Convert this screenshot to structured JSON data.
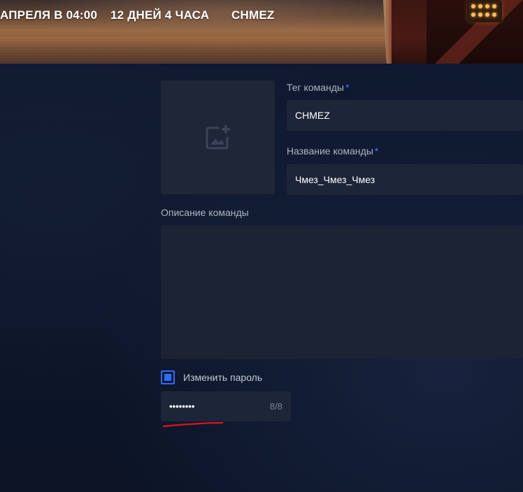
{
  "banner": {
    "date_text": "АПРЕЛЯ В 04:00",
    "countdown_text": "12 ДНЕЙ 4 ЧАСА",
    "team_text": "CHMEZ"
  },
  "form": {
    "logo_upload": {
      "icon": "add-photo-icon"
    },
    "team_tag": {
      "label": "Тег команды",
      "required_mark": "*",
      "value": "CHMEZ"
    },
    "team_name": {
      "label": "Название команды",
      "required_mark": "*",
      "value": "Чмез_Чмез_Чмез"
    },
    "description": {
      "label": "Описание команды",
      "value": ""
    },
    "change_password": {
      "label": "Изменить пароль",
      "checked": true
    },
    "password": {
      "value": "••••••••",
      "counter": "8/8"
    }
  },
  "colors": {
    "background": "#0e1628",
    "input_background": "#1d2538",
    "accent": "#2f6bff",
    "annotation": "#e0141e"
  }
}
